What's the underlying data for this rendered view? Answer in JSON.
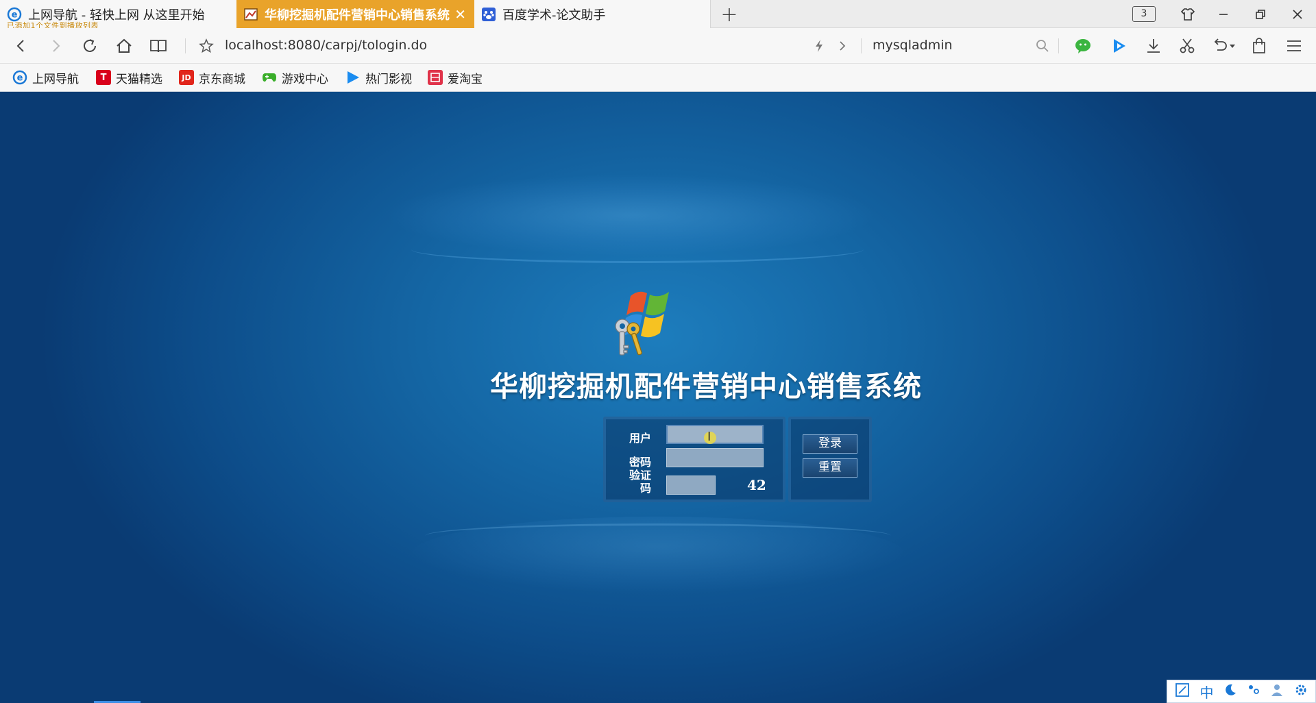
{
  "tabs": [
    {
      "title": "上网导航 - 轻快上网 从这里开始",
      "icon": "ie-e-icon"
    },
    {
      "title": "华柳挖掘机配件营销中心销售系统",
      "icon": "login-page-icon",
      "active": true
    },
    {
      "title": "百度学术-论文助手",
      "icon": "baidu-paw-icon"
    }
  ],
  "tab_notice": "已添加1个文件到播放列表",
  "tab_count": "3",
  "address": {
    "url": "localhost:8080/carpj/tologin.do",
    "search_text": "mysqladmin"
  },
  "bookmarks": [
    {
      "label": "上网导航",
      "icon": "ie-e-icon",
      "color": "#1a78d6"
    },
    {
      "label": "天猫精选",
      "icon": "tmall-icon",
      "color": "#d9001b",
      "glyph": "T"
    },
    {
      "label": "京东商城",
      "icon": "jd-icon",
      "color": "#e1251b",
      "glyph": "JD"
    },
    {
      "label": "游戏中心",
      "icon": "gamepad-icon",
      "color": "#3aae2a"
    },
    {
      "label": "热门影视",
      "icon": "video-play-icon",
      "color": "#1a8cf0"
    },
    {
      "label": "爱淘宝",
      "icon": "taobao-icon",
      "color": "#e0334a"
    }
  ],
  "page": {
    "system_title": "华柳挖掘机配件营销中心销售系统",
    "username_label": "用户",
    "password_label": "密码",
    "captcha_label_line1": "验证",
    "captcha_label_line2": "码",
    "captcha_value": "42",
    "login_button": "登录",
    "reset_button": "重置"
  },
  "ime": {
    "mode": "中"
  },
  "colors": {
    "active_tab": "#e9a32a",
    "page_background": "#1465a3",
    "field_fill": "#8fa9c2"
  }
}
